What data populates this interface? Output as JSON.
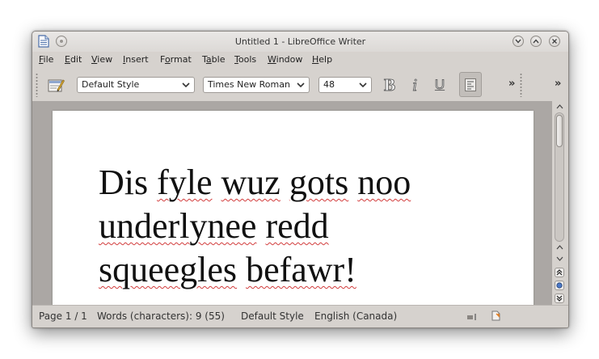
{
  "window": {
    "title": "Untitled 1 - LibreOffice Writer"
  },
  "menu": [
    {
      "first": "F",
      "rest": "ile"
    },
    {
      "first": "E",
      "rest": "dit"
    },
    {
      "first": "V",
      "rest": "iew"
    },
    {
      "first": "I",
      "rest": "nsert"
    },
    {
      "first": "F",
      "rest": "ormat",
      "pre": "",
      "u_index": 1
    },
    {
      "first": "T",
      "rest": "able"
    },
    {
      "first": "T",
      "rest": "ools"
    },
    {
      "first": "W",
      "rest": "indow"
    },
    {
      "first": "H",
      "rest": "elp"
    }
  ],
  "menu_labels": {
    "file": [
      "F",
      "ile"
    ],
    "edit": [
      "E",
      "dit"
    ],
    "view": [
      "V",
      "iew"
    ],
    "insert": [
      "I",
      "nsert"
    ],
    "format_pre": "F",
    "format_u": "o",
    "format_post": "rmat",
    "table_pre": "T",
    "table_u": "a",
    "table_post": "ble",
    "tools": [
      "T",
      "ools"
    ],
    "window": [
      "W",
      "indow"
    ],
    "help": [
      "H",
      "elp"
    ]
  },
  "toolbar": {
    "paragraph_style": "Default Style",
    "font_name": "Times New Roman",
    "font_size": "48",
    "bold_label": "B",
    "italic_label": "i",
    "underline_label": "U",
    "overflow_label": "»",
    "overflow_label_2": "»"
  },
  "document": {
    "line1": [
      "Dis",
      "fyle",
      "wuz",
      "gots",
      "noo"
    ],
    "line2": [
      "underlynee",
      "redd"
    ],
    "line3": [
      "squeegles",
      "befawr!"
    ]
  },
  "status": {
    "page": "Page 1 / 1",
    "words": "Words (characters): 9 (55)",
    "style": "Default Style",
    "language": "English (Canada)"
  },
  "colors": {
    "accent_spell": "#d23c3c",
    "chrome": "#d6d2ce",
    "canvas": "#aba7a4"
  }
}
